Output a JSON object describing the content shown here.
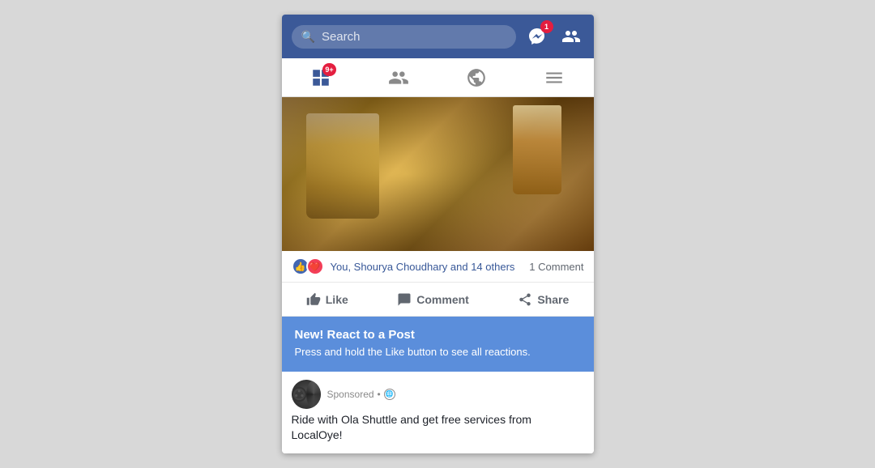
{
  "header": {
    "search_placeholder": "Search",
    "messenger_badge": "1",
    "friends_badge": ""
  },
  "secondary_nav": {
    "tabs": [
      {
        "name": "feed",
        "badge": "9+",
        "active": true
      },
      {
        "name": "friends",
        "badge": "",
        "active": false
      },
      {
        "name": "globe",
        "badge": "",
        "active": false
      },
      {
        "name": "menu",
        "badge": "",
        "active": false
      }
    ]
  },
  "post": {
    "reactions_text": "You, Shourya Choudhary and 14 others",
    "comment_count": "1 Comment",
    "like_label": "Like",
    "comment_label": "Comment",
    "share_label": "Share"
  },
  "tooltip": {
    "title": "New! React to a Post",
    "body": "Press and hold the Like button to see all reactions."
  },
  "sponsored": {
    "label": "Sponsored",
    "ad_text": "Ride with Ola Shuttle and get free services from LocalOye!"
  }
}
